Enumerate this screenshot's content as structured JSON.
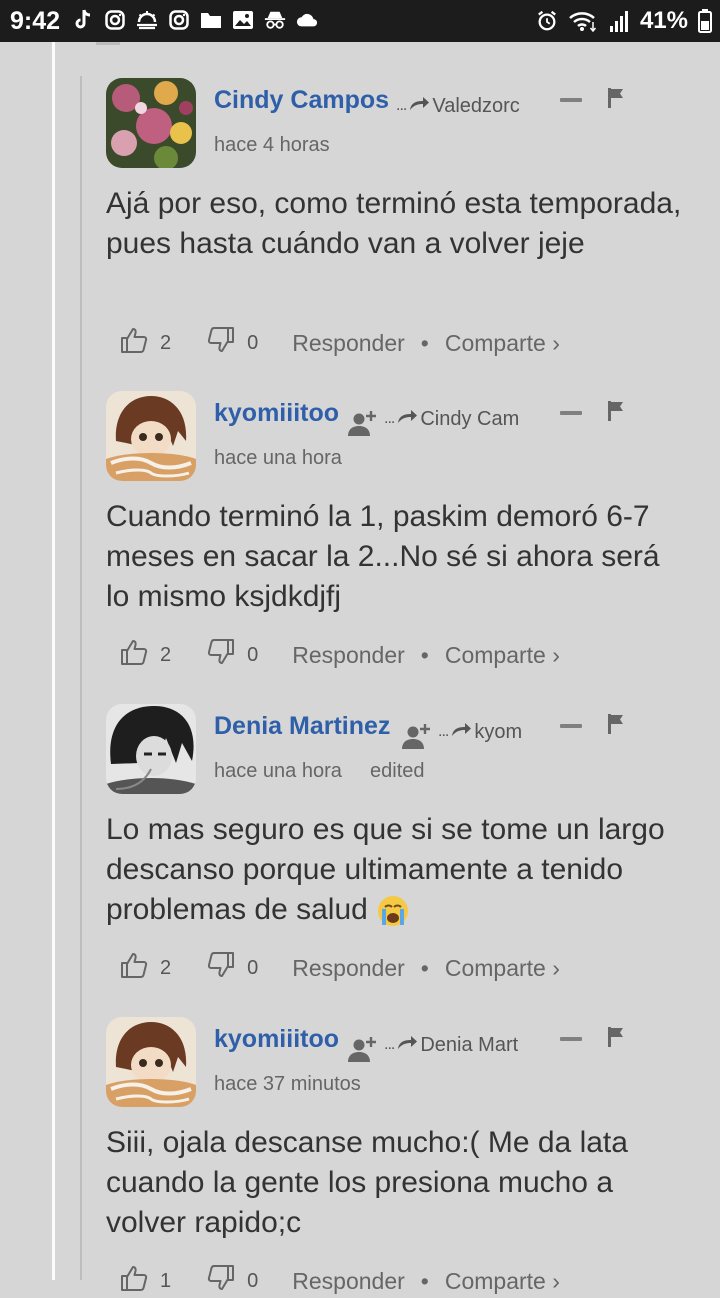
{
  "status_bar": {
    "time": "9:42",
    "battery": "41%",
    "icons": [
      "tiktok-icon",
      "instagram-icon",
      "weather-icon",
      "instagram-icon",
      "folder-icon",
      "gallery-icon",
      "incognito-icon",
      "cloud-icon"
    ],
    "right_icons": [
      "alarm-icon",
      "wifi-icon",
      "signal-icon"
    ]
  },
  "comments": [
    {
      "author": "Cindy Campos",
      "reply_to": "Valedzorc",
      "timestamp": "hace 4 horas",
      "edited": "",
      "has_follow": false,
      "avatar": "flowers",
      "body": "Ajá por eso, como terminó esta temporada, pues hasta cuándo van a volver jeje",
      "likes": "2",
      "dislikes": "0"
    },
    {
      "author": "kyomiiitoo",
      "reply_to": "Cindy Cam",
      "timestamp": "hace una hora",
      "edited": "",
      "has_follow": true,
      "avatar": "anime-girl",
      "body": "Cuando terminó la 1, paskim demoró 6-7 meses en sacar la 2...No sé si ahora será lo mismo ksjdkdjfj",
      "likes": "2",
      "dislikes": "0"
    },
    {
      "author": "Denia Martinez",
      "reply_to": "kyom",
      "timestamp": "hace una hora",
      "edited": "edited",
      "has_follow": true,
      "avatar": "anime-boy",
      "body": "Lo mas seguro es que si se tome un largo descanso porque ultimamente a tenido problemas de salud",
      "likes": "2",
      "dislikes": "0"
    },
    {
      "author": "kyomiiitoo",
      "reply_to": "Denia Mart",
      "timestamp": "hace 37 minutos",
      "edited": "",
      "has_follow": true,
      "avatar": "anime-girl",
      "body": "Siii, ojala descanse mucho:( Me da lata cuando la gente los presiona mucho a volver rapido;c",
      "likes": "1",
      "dislikes": "0"
    }
  ],
  "labels": {
    "reply": "Responder",
    "share": "Comparte ›",
    "separator": "•"
  },
  "colors": {
    "author": "#2e5fa8",
    "background": "#d6d6d6",
    "status_bar": "#1c1c1c"
  }
}
